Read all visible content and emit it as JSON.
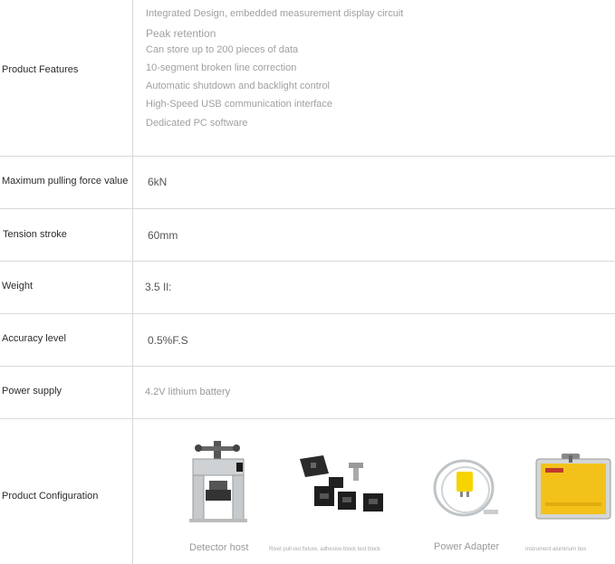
{
  "features": {
    "label": "Product Features",
    "items": [
      "Integrated Design, embedded measurement display circuit",
      "Peak retention",
      "Can store up to 200 pieces of data",
      "10-segment broken line correction",
      "Automatic shutdown and backlight control",
      "High-Speed USB communication interface",
      "Dedicated PC software"
    ]
  },
  "specs": [
    {
      "label": "Maximum pulling force value",
      "value": "6kN"
    },
    {
      "label": "Tension stroke",
      "value": "60mm"
    },
    {
      "label": "Weight",
      "value": "3.5 Il:"
    },
    {
      "label": "Accuracy level",
      "value": "0.5%F.S"
    },
    {
      "label": "Power supply",
      "value": "4.2V lithium battery"
    }
  ],
  "configuration": {
    "label": "Product Configuration",
    "items": [
      {
        "name": "Detector host",
        "icon": "detector-host-icon"
      },
      {
        "name": "Rivet pull-out fixture, adhesive block test block",
        "icon": "fixture-blocks-icon"
      },
      {
        "name": "Power Adapter",
        "icon": "power-adapter-icon"
      },
      {
        "name": "Instrument aluminum box",
        "icon": "aluminum-case-icon"
      }
    ]
  },
  "colors": {
    "border": "#d9d9d9",
    "case_yellow": "#f2c21b",
    "adapter_yellow": "#f5d400"
  }
}
